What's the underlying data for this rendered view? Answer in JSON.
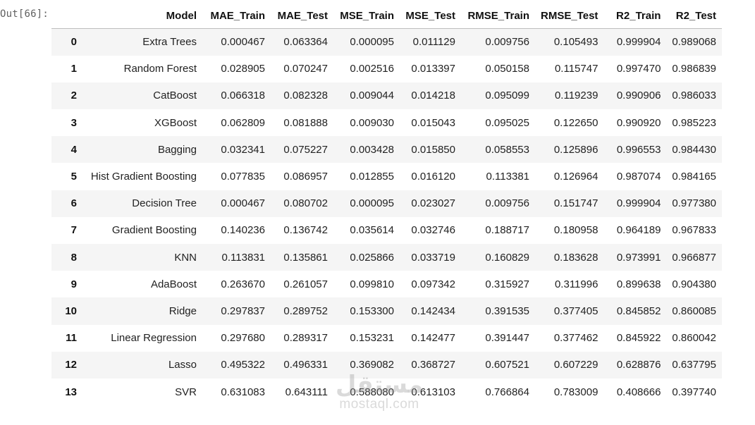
{
  "cell": {
    "prompt": "Out[66]:"
  },
  "table": {
    "columns": [
      "",
      "Model",
      "MAE_Train",
      "MAE_Test",
      "MSE_Train",
      "MSE_Test",
      "RMSE_Train",
      "RMSE_Test",
      "R2_Train",
      "R2_Test"
    ],
    "rows": [
      [
        "0",
        "Extra Trees",
        "0.000467",
        "0.063364",
        "0.000095",
        "0.011129",
        "0.009756",
        "0.105493",
        "0.999904",
        "0.989068"
      ],
      [
        "1",
        "Random Forest",
        "0.028905",
        "0.070247",
        "0.002516",
        "0.013397",
        "0.050158",
        "0.115747",
        "0.997470",
        "0.986839"
      ],
      [
        "2",
        "CatBoost",
        "0.066318",
        "0.082328",
        "0.009044",
        "0.014218",
        "0.095099",
        "0.119239",
        "0.990906",
        "0.986033"
      ],
      [
        "3",
        "XGBoost",
        "0.062809",
        "0.081888",
        "0.009030",
        "0.015043",
        "0.095025",
        "0.122650",
        "0.990920",
        "0.985223"
      ],
      [
        "4",
        "Bagging",
        "0.032341",
        "0.075227",
        "0.003428",
        "0.015850",
        "0.058553",
        "0.125896",
        "0.996553",
        "0.984430"
      ],
      [
        "5",
        "Hist Gradient Boosting",
        "0.077835",
        "0.086957",
        "0.012855",
        "0.016120",
        "0.113381",
        "0.126964",
        "0.987074",
        "0.984165"
      ],
      [
        "6",
        "Decision Tree",
        "0.000467",
        "0.080702",
        "0.000095",
        "0.023027",
        "0.009756",
        "0.151747",
        "0.999904",
        "0.977380"
      ],
      [
        "7",
        "Gradient Boosting",
        "0.140236",
        "0.136742",
        "0.035614",
        "0.032746",
        "0.188717",
        "0.180958",
        "0.964189",
        "0.967833"
      ],
      [
        "8",
        "KNN",
        "0.113831",
        "0.135861",
        "0.025866",
        "0.033719",
        "0.160829",
        "0.183628",
        "0.973991",
        "0.966877"
      ],
      [
        "9",
        "AdaBoost",
        "0.263670",
        "0.261057",
        "0.099810",
        "0.097342",
        "0.315927",
        "0.311996",
        "0.899638",
        "0.904380"
      ],
      [
        "10",
        "Ridge",
        "0.297837",
        "0.289752",
        "0.153300",
        "0.142434",
        "0.391535",
        "0.377405",
        "0.845852",
        "0.860085"
      ],
      [
        "11",
        "Linear Regression",
        "0.297680",
        "0.289317",
        "0.153231",
        "0.142477",
        "0.391447",
        "0.377462",
        "0.845922",
        "0.860042"
      ],
      [
        "12",
        "Lasso",
        "0.495322",
        "0.496331",
        "0.369082",
        "0.368727",
        "0.607521",
        "0.607229",
        "0.628876",
        "0.637795"
      ],
      [
        "13",
        "SVR",
        "0.631083",
        "0.643111",
        "0.588080",
        "0.613103",
        "0.766864",
        "0.783009",
        "0.408666",
        "0.397740"
      ]
    ]
  },
  "watermark": {
    "logo": "مستقل",
    "text": "mostaql.com"
  }
}
